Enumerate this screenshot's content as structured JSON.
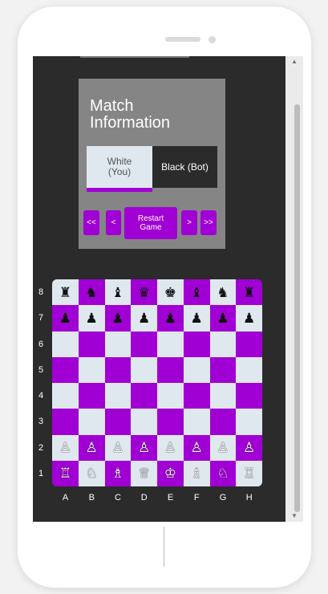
{
  "match": {
    "title": "Match Information",
    "white_player": "White (You)",
    "black_player": "Black (Bot)",
    "turn": "white"
  },
  "controls": {
    "first": "<<",
    "prev": "<",
    "restart": "Restart Game",
    "next": ">",
    "last": ">>"
  },
  "colors": {
    "accent": "#a000d4",
    "light_square": "#dfe7ef",
    "screen_bg": "#2b2b2b",
    "panel_bg": "#858585"
  },
  "scrollbar": {
    "up": "▲",
    "down": "▼"
  },
  "board": {
    "ranks": [
      "8",
      "7",
      "6",
      "5",
      "4",
      "3",
      "2",
      "1"
    ],
    "files": [
      "A",
      "B",
      "C",
      "D",
      "E",
      "F",
      "G",
      "H"
    ],
    "rows": [
      [
        "♜",
        "♞",
        "♝",
        "♛",
        "♚",
        "♝",
        "♞",
        "♜"
      ],
      [
        "♟",
        "♟",
        "♟",
        "♟",
        "♟",
        "♟",
        "♟",
        "♟"
      ],
      [
        "",
        "",
        "",
        "",
        "",
        "",
        "",
        ""
      ],
      [
        "",
        "",
        "",
        "",
        "",
        "",
        "",
        ""
      ],
      [
        "",
        "",
        "",
        "",
        "",
        "",
        "",
        ""
      ],
      [
        "",
        "",
        "",
        "",
        "",
        "",
        "",
        ""
      ],
      [
        "♙",
        "♙",
        "♙",
        "♙",
        "♙",
        "♙",
        "♙",
        "♙"
      ],
      [
        "♖",
        "♘",
        "♗",
        "♕",
        "♔",
        "♗",
        "♘",
        "♖"
      ]
    ]
  }
}
